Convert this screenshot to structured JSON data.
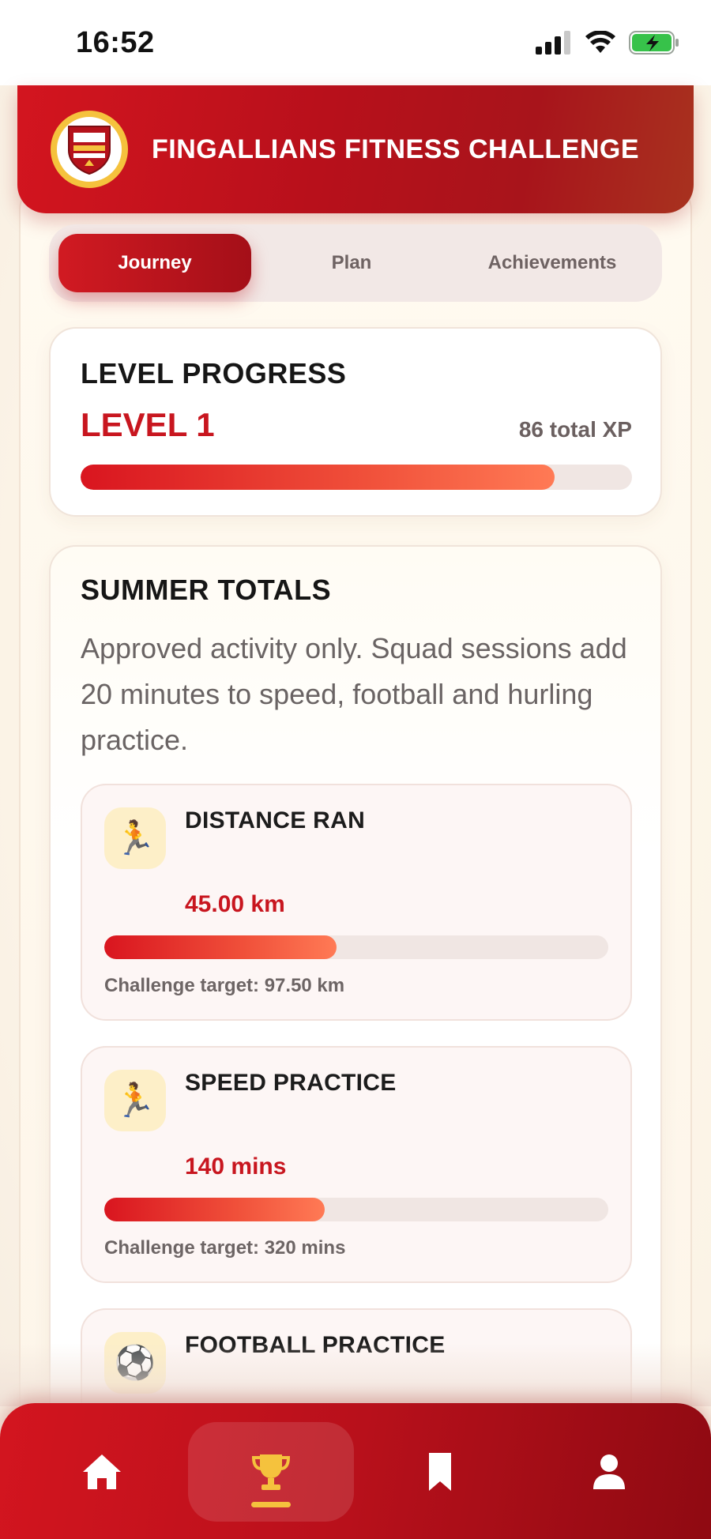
{
  "status_bar": {
    "time": "16:52"
  },
  "header": {
    "title": "FINGALLIANS FITNESS CHALLENGE"
  },
  "tabs": [
    {
      "label": "Journey",
      "active": true
    },
    {
      "label": "Plan",
      "active": false
    },
    {
      "label": "Achievements",
      "active": false
    }
  ],
  "level": {
    "heading": "LEVEL PROGRESS",
    "level_label": "LEVEL 1",
    "xp_label": "86 total XP",
    "progress": 0.86
  },
  "summer": {
    "heading": "SUMMER TOTALS",
    "description": "Approved activity only. Squad sessions add 20 minutes to speed, football and hurling practice.",
    "metrics": [
      {
        "icon": "runner-icon",
        "emoji": "🏃",
        "title": "DISTANCE RAN",
        "value": "45.00 km",
        "target": "Challenge target: 97.50 km",
        "progress": 0.4615
      },
      {
        "icon": "runner-icon",
        "emoji": "🏃",
        "title": "SPEED PRACTICE",
        "value": "140 mins",
        "target": "Challenge target: 320 mins",
        "progress": 0.4375
      },
      {
        "icon": "soccer-ball-icon",
        "emoji": "⚽",
        "title": "FOOTBALL PRACTICE",
        "value": "",
        "target": "",
        "progress": 0
      }
    ]
  },
  "bottom_nav": [
    {
      "icon": "home-icon",
      "active": false
    },
    {
      "icon": "trophy-icon",
      "active": true
    },
    {
      "icon": "bookmark-icon",
      "active": false
    },
    {
      "icon": "profile-icon",
      "active": false
    }
  ],
  "colors": {
    "brand_red": "#c8161f",
    "accent_gold": "#f5c23d"
  }
}
